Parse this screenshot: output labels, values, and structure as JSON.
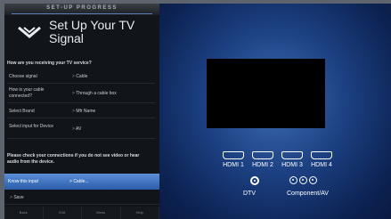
{
  "header": {
    "progress_label": "SET-UP PROGRESS",
    "title": "Set Up Your TV Signal"
  },
  "menu": {
    "question": "How are you receiving your TV service?",
    "rows": [
      {
        "label": "Choose signal",
        "value": "Cable"
      },
      {
        "label": "How is your cable connected?",
        "value": "Through a cable box"
      },
      {
        "label": "Select Brand",
        "value": "Mfr Name"
      },
      {
        "label": "Select input for Device",
        "value": "AV"
      }
    ],
    "note": "Please check your connections if you do not see video or hear audio from the device.",
    "highlighted": {
      "label": "Know this input",
      "value": "Cable..."
    },
    "save_label": "Save",
    "bottom_buttons": [
      "Back",
      "Exit",
      "Menu",
      "Help"
    ]
  },
  "diagram": {
    "hdmi_ports": [
      "HDMI 1",
      "HDMI 2",
      "HDMI 3",
      "HDMI 4"
    ],
    "dtv_label": "DTV",
    "component_label": "Component/AV"
  },
  "colors": {
    "panel_bg": "#111418",
    "highlight": "#3f78c8",
    "stage_center": "#3d6db2",
    "stage_edge": "#0a1a40"
  }
}
